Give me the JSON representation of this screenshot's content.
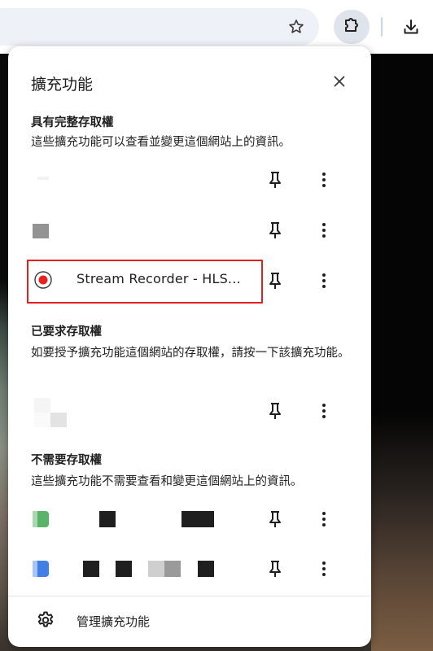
{
  "popup": {
    "title": "擴充功能",
    "sections": [
      {
        "title": "具有完整存取權",
        "description": "這些擴充功能可以查看並變更這個網站上的資訊。",
        "highlighted_extension": "Stream Recorder - HLS..."
      },
      {
        "title": "已要求存取權",
        "description": "如要授予擴充功能這個網站的存取權，請按一下該擴充功能。"
      },
      {
        "title": "不需要存取權",
        "description": "這些擴充功能不需要查看和變更這個網站上的資訊。"
      }
    ],
    "footer": {
      "manage_label": "管理擴充功能"
    }
  },
  "icons": {
    "toolbar": [
      "star-icon",
      "puzzle-icon",
      "download-icon"
    ],
    "rows": [
      "pin-icon",
      "more-vert-icon"
    ],
    "footer": "gear-icon",
    "close": "close-icon",
    "record": "record-icon"
  },
  "colors": {
    "highlight": "#e0201e",
    "record_red": "#e8231f",
    "accent": "#1a73e8"
  }
}
